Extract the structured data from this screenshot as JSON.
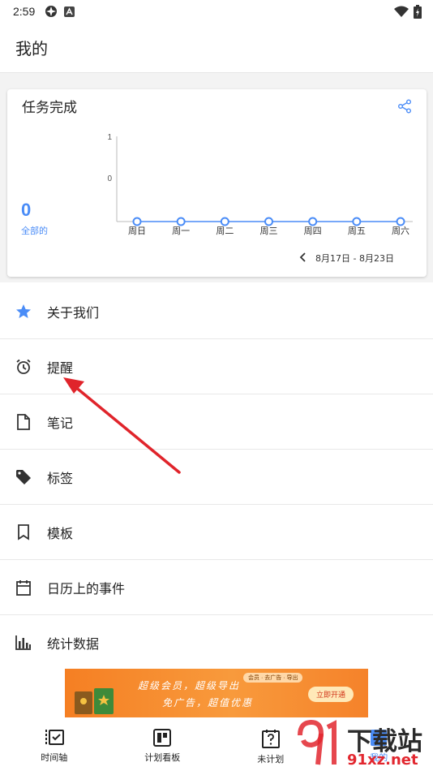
{
  "status_bar": {
    "time": "2:59"
  },
  "header": {
    "title": "我的"
  },
  "card": {
    "title": "任务完成",
    "total_value": "0",
    "total_label": "全部的",
    "date_range": "8月17日 - 8月23日"
  },
  "chart_data": {
    "type": "line",
    "categories": [
      "周日",
      "周一",
      "周二",
      "周三",
      "周四",
      "周五",
      "周六"
    ],
    "series": [
      {
        "values": [
          0,
          0,
          0,
          0,
          0,
          0,
          0
        ],
        "color": "#4a8cf7"
      }
    ],
    "y_ticks": [
      "1",
      "0"
    ],
    "ylim": [
      0,
      1
    ],
    "grid": false
  },
  "menu": {
    "items": [
      {
        "label": "关于我们",
        "icon": "star-icon"
      },
      {
        "label": "提醒",
        "icon": "alarm-icon"
      },
      {
        "label": "笔记",
        "icon": "note-icon"
      },
      {
        "label": "标签",
        "icon": "tag-icon"
      },
      {
        "label": "模板",
        "icon": "bookmark-icon"
      },
      {
        "label": "日历上的事件",
        "icon": "calendar-icon"
      },
      {
        "label": "统计数据",
        "icon": "bar-chart-icon"
      }
    ]
  },
  "ad": {
    "line1": "超级会员，超级导出",
    "line2": "免广告，超值优惠",
    "tags": "会员 · 去广告 · 导出",
    "button": "立即开通"
  },
  "bottom_nav": {
    "items": [
      {
        "label": "时间轴",
        "icon": "timeline-icon"
      },
      {
        "label": "计划看板",
        "icon": "board-icon"
      },
      {
        "label": "未计划",
        "icon": "unplanned-icon"
      },
      {
        "label": "我的",
        "icon": "profile-icon"
      }
    ]
  },
  "watermark": {
    "top": "下载站",
    "bottom": "91xz.net"
  },
  "colors": {
    "accent": "#4a8cf7",
    "arrow": "#e0242b",
    "ad": "#f5822a"
  }
}
